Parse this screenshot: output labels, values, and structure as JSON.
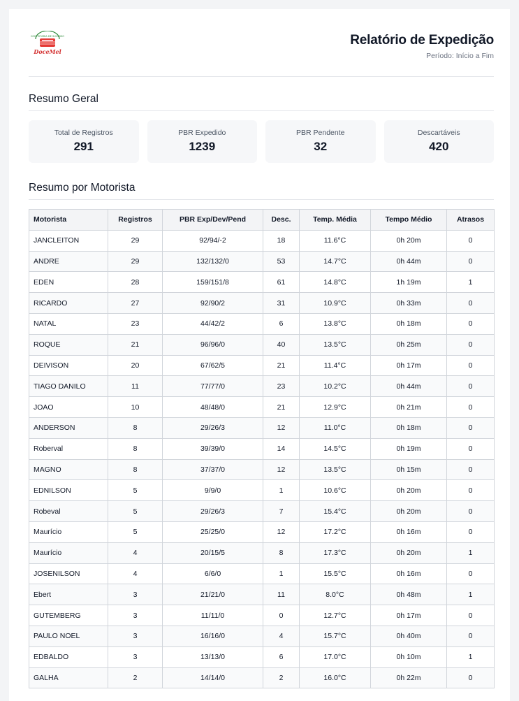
{
  "logo": {
    "top_text": "CONFEITARIA DE SUCESSO",
    "brand": "DoceMel"
  },
  "header": {
    "title": "Relatório de Expedição",
    "period": "Período: Início a Fim"
  },
  "summary": {
    "title": "Resumo Geral",
    "cards": [
      {
        "label": "Total de Registros",
        "value": "291"
      },
      {
        "label": "PBR Expedido",
        "value": "1239"
      },
      {
        "label": "PBR Pendente",
        "value": "32"
      },
      {
        "label": "Descartáveis",
        "value": "420"
      }
    ]
  },
  "drivers": {
    "title": "Resumo por Motorista",
    "columns": [
      "Motorista",
      "Registros",
      "PBR Exp/Dev/Pend",
      "Desc.",
      "Temp. Média",
      "Tempo Médio",
      "Atrasos"
    ],
    "rows": [
      [
        "JANCLEITON",
        "29",
        "92/94/-2",
        "18",
        "11.6°C",
        "0h 20m",
        "0"
      ],
      [
        "ANDRE",
        "29",
        "132/132/0",
        "53",
        "14.7°C",
        "0h 44m",
        "0"
      ],
      [
        "EDEN",
        "28",
        "159/151/8",
        "61",
        "14.8°C",
        "1h 19m",
        "1"
      ],
      [
        "RICARDO",
        "27",
        "92/90/2",
        "31",
        "10.9°C",
        "0h 33m",
        "0"
      ],
      [
        "NATAL",
        "23",
        "44/42/2",
        "6",
        "13.8°C",
        "0h 18m",
        "0"
      ],
      [
        "ROQUE",
        "21",
        "96/96/0",
        "40",
        "13.5°C",
        "0h 25m",
        "0"
      ],
      [
        "DEIVISON",
        "20",
        "67/62/5",
        "21",
        "11.4°C",
        "0h 17m",
        "0"
      ],
      [
        "TIAGO DANILO",
        "11",
        "77/77/0",
        "23",
        "10.2°C",
        "0h 44m",
        "0"
      ],
      [
        "JOAO",
        "10",
        "48/48/0",
        "21",
        "12.9°C",
        "0h 21m",
        "0"
      ],
      [
        "ANDERSON",
        "8",
        "29/26/3",
        "12",
        "11.0°C",
        "0h 18m",
        "0"
      ],
      [
        "Roberval",
        "8",
        "39/39/0",
        "14",
        "14.5°C",
        "0h 19m",
        "0"
      ],
      [
        "MAGNO",
        "8",
        "37/37/0",
        "12",
        "13.5°C",
        "0h 15m",
        "0"
      ],
      [
        "EDNILSON",
        "5",
        "9/9/0",
        "1",
        "10.6°C",
        "0h 20m",
        "0"
      ],
      [
        "Robeval",
        "5",
        "29/26/3",
        "7",
        "15.4°C",
        "0h 20m",
        "0"
      ],
      [
        "Maurício",
        "5",
        "25/25/0",
        "12",
        "17.2°C",
        "0h 16m",
        "0"
      ],
      [
        "Maurício",
        "4",
        "20/15/5",
        "8",
        "17.3°C",
        "0h 20m",
        "1"
      ],
      [
        "JOSENILSON",
        "4",
        "6/6/0",
        "1",
        "15.5°C",
        "0h 16m",
        "0"
      ],
      [
        "Ebert",
        "3",
        "21/21/0",
        "11",
        "8.0°C",
        "0h 48m",
        "1"
      ],
      [
        "GUTEMBERG",
        "3",
        "11/11/0",
        "0",
        "12.7°C",
        "0h 17m",
        "0"
      ],
      [
        "PAULO NOEL",
        "3",
        "16/16/0",
        "4",
        "15.7°C",
        "0h 40m",
        "0"
      ],
      [
        "EDBALDO",
        "3",
        "13/13/0",
        "6",
        "17.0°C",
        "0h 10m",
        "1"
      ],
      [
        "GALHA",
        "2",
        "14/14/0",
        "2",
        "16.0°C",
        "0h 22m",
        "0"
      ]
    ]
  }
}
